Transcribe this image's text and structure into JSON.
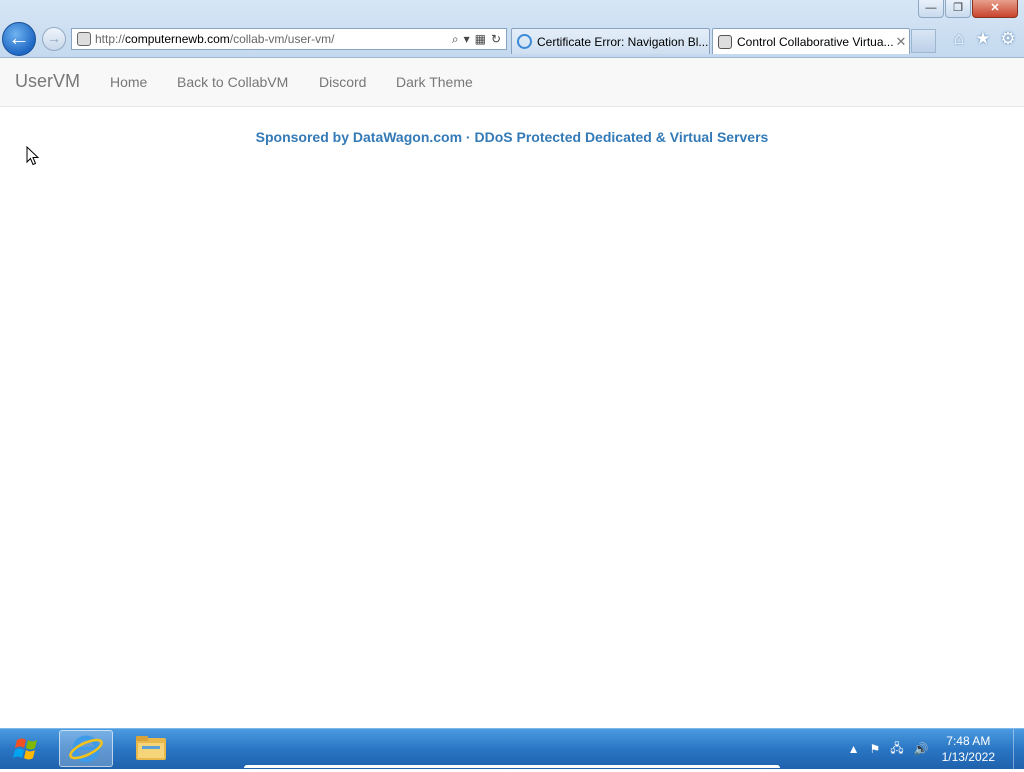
{
  "browser": {
    "window_controls": {
      "minimize": "—",
      "restore": "❐",
      "close": "✕"
    },
    "back_icon": "←",
    "forward_icon": "→",
    "address": {
      "scheme": "http://",
      "domain": "computernewb.com",
      "path": "/collab-vm/user-vm/",
      "search_icon": "⌕",
      "dropdown_icon": "▾",
      "compat_icon": "▦",
      "refresh_icon": "↻"
    },
    "tabs": [
      {
        "label": "Certificate Error: Navigation Bl..."
      },
      {
        "label": "Control Collaborative Virtua...",
        "close": "✕"
      }
    ],
    "commands": {
      "home": "⌂",
      "favorites": "★",
      "tools": "⚙"
    }
  },
  "navbar": {
    "brand": "UserVM",
    "links": [
      "Home",
      "Back to CollabVM",
      "Discord",
      "Dark Theme"
    ]
  },
  "sponsor": "Sponsored by DataWagon.com · DDoS Protected Dedicated & Virtual Servers",
  "colors": {
    "link": "#337ab7",
    "nav_text": "#777777",
    "navbar_bg": "#f8f8f8"
  },
  "taskbar": {
    "tray": {
      "show_hidden": "▲",
      "flag": "⚑",
      "network": "🖧",
      "volume": "🔊"
    },
    "clock": {
      "time": "7:48 AM",
      "date": "1/13/2022"
    }
  }
}
